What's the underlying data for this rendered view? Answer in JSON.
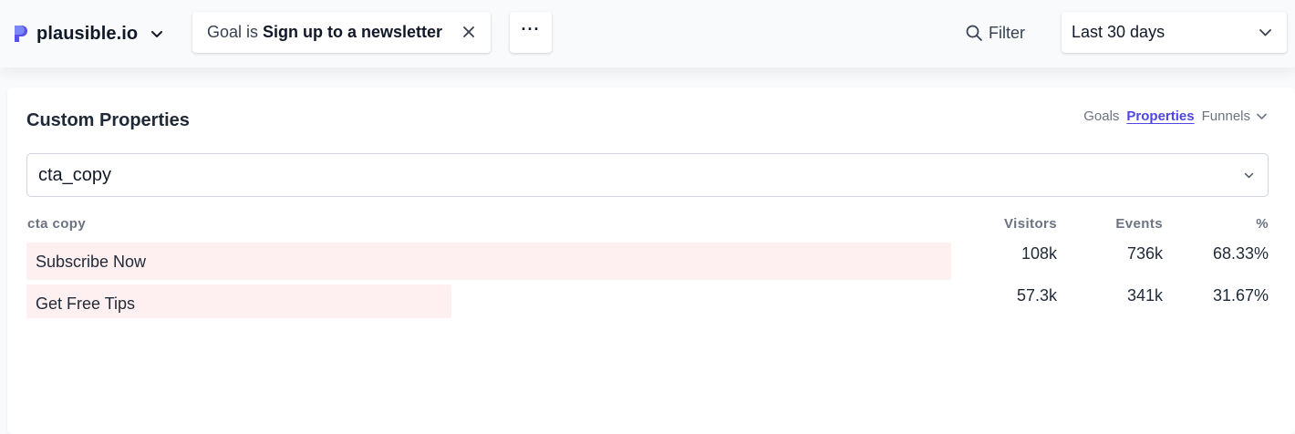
{
  "header": {
    "site_name": "plausible.io",
    "goal_filter": {
      "prefix": "Goal is",
      "value": "Sign up to a newsletter"
    },
    "more_label": "···",
    "filter_label": "Filter",
    "date_range": "Last 30 days"
  },
  "panel": {
    "title": "Custom Properties",
    "tabs": [
      {
        "label": "Goals",
        "active": false
      },
      {
        "label": "Properties",
        "active": true
      },
      {
        "label": "Funnels",
        "active": false
      }
    ],
    "selected_property": "cta_copy",
    "columns": {
      "name": "cta copy",
      "visitors": "Visitors",
      "events": "Events",
      "percent": "%"
    },
    "rows": [
      {
        "label": "Subscribe Now",
        "visitors": "108k",
        "events": "736k",
        "percent": "68.33%",
        "bar_fraction": 1.0
      },
      {
        "label": "Get Free Tips",
        "visitors": "57.3k",
        "events": "341k",
        "percent": "31.67%",
        "bar_fraction": 0.46
      }
    ]
  },
  "colors": {
    "accent": "#4f46e5",
    "bar": "#fef0f0",
    "logo": "#5850ec"
  }
}
